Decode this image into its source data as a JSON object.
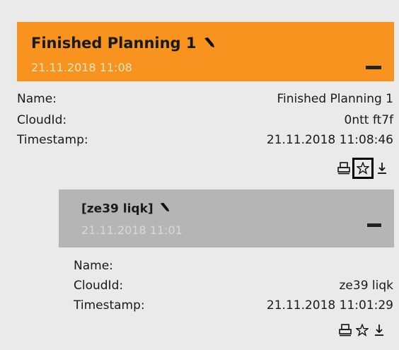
{
  "card": {
    "title": "Finished Planning 1",
    "subtitle": "21.11.2018 11:08",
    "fields": {
      "name_label": "Name:",
      "name_value": "Finished Planning 1",
      "cloudid_label": "CloudId:",
      "cloudid_value": "0ntt ft7f",
      "timestamp_label": "Timestamp:",
      "timestamp_value": "21.11.2018 11:08:46"
    }
  },
  "child": {
    "title": "[ze39 liqk]",
    "subtitle": "21.11.2018 11:01",
    "fields": {
      "name_label": "Name:",
      "name_value": "",
      "cloudid_label": "CloudId:",
      "cloudid_value": "ze39 liqk",
      "timestamp_label": "Timestamp:",
      "timestamp_value": "21.11.2018 11:01:29"
    }
  },
  "icons": {
    "edit": "pencil-icon",
    "collapse": "minus-icon",
    "print": "print-icon",
    "favorite": "star-icon",
    "download": "download-icon"
  },
  "colors": {
    "primary_header": "#f7931e",
    "child_header": "#b5b5b5",
    "background": "#eaeaea"
  }
}
